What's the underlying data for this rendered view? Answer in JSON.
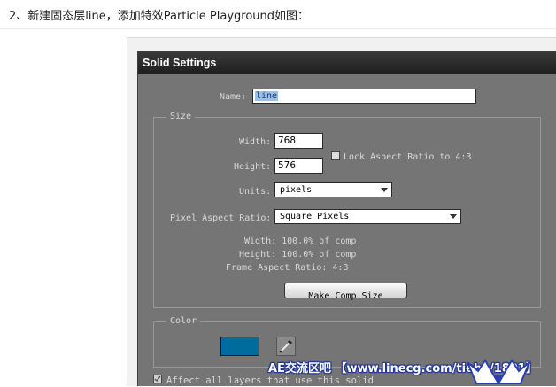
{
  "caption": "2、新建固态层line，添加特效Particle Playground如图：",
  "dialog": {
    "title": "Solid Settings",
    "name_label": "Name:",
    "name_value": "line",
    "size_group": {
      "legend": "Size",
      "width_label": "Width:",
      "width_value": "768",
      "height_label": "Height:",
      "height_value": "576",
      "lock_label": "Lock Aspect Ratio to 4:3",
      "lock_checked": false,
      "units_label": "Units:",
      "units_value": "pixels",
      "par_label": "Pixel Aspect Ratio:",
      "par_value": "Square Pixels",
      "info_width": "Width:  100.0% of comp",
      "info_height": "Height:  100.0% of comp",
      "info_frame": "Frame Aspect Ratio: 4:3",
      "make_comp_size_label": "Make Comp Size"
    },
    "color_group": {
      "legend": "Color",
      "swatch_color": "#006c9e"
    },
    "affect_label": "Affect all layers that use this solid",
    "affect_checked": true
  },
  "watermark": {
    "text": "AE交流区吧 【www.linecg.com/tieba/1801】"
  }
}
